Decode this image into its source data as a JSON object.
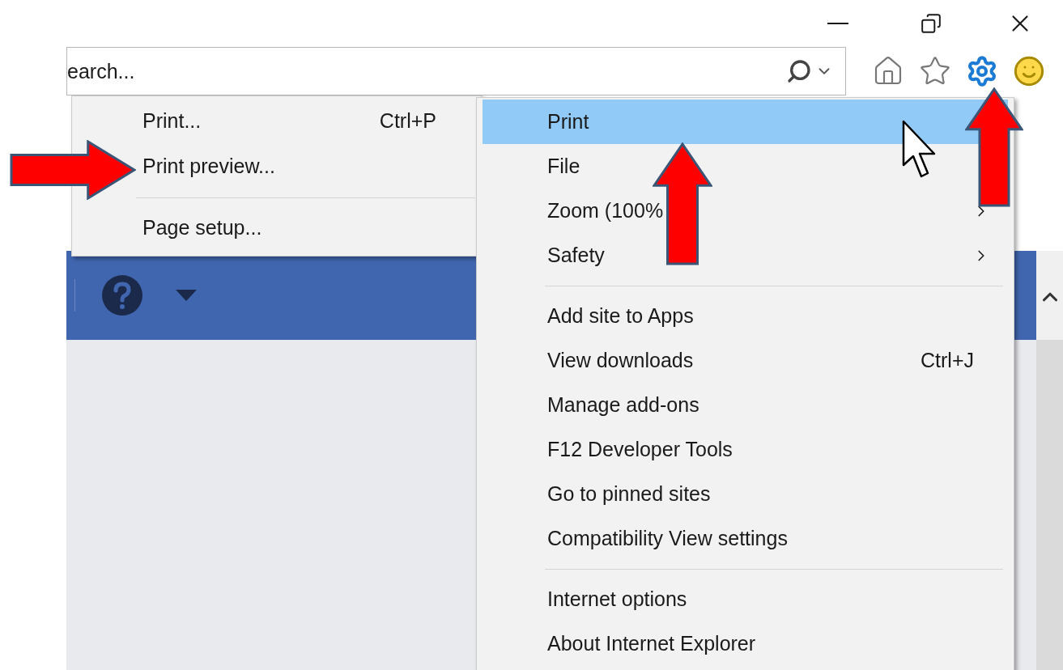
{
  "search": {
    "placeholder": "earch..."
  },
  "print_submenu": {
    "items": [
      {
        "kind": "item",
        "label": "Print...",
        "shortcut": "Ctrl+P"
      },
      {
        "kind": "item",
        "label": "Print preview..."
      },
      {
        "kind": "separator"
      },
      {
        "kind": "item",
        "label": "Page setup..."
      }
    ]
  },
  "tools_menu": {
    "items": [
      {
        "kind": "item",
        "label": "Print",
        "selected": true,
        "submenu": false
      },
      {
        "kind": "item",
        "label": "File",
        "selected": false,
        "submenu": false
      },
      {
        "kind": "item",
        "label": "Zoom (100%",
        "selected": false,
        "submenu": true
      },
      {
        "kind": "item",
        "label": "Safety",
        "selected": false,
        "submenu": true
      },
      {
        "kind": "separator"
      },
      {
        "kind": "item",
        "label": "Add site to Apps",
        "selected": false,
        "submenu": false
      },
      {
        "kind": "item",
        "label": "View downloads",
        "shortcut": "Ctrl+J",
        "selected": false,
        "submenu": false
      },
      {
        "kind": "item",
        "label": "Manage add-ons",
        "selected": false,
        "submenu": false
      },
      {
        "kind": "item",
        "label": "F12 Developer Tools",
        "selected": false,
        "submenu": false
      },
      {
        "kind": "item",
        "label": "Go to pinned sites",
        "selected": false,
        "submenu": false
      },
      {
        "kind": "item",
        "label": "Compatibility View settings",
        "selected": false,
        "submenu": false
      },
      {
        "kind": "separator"
      },
      {
        "kind": "item",
        "label": "Internet options",
        "selected": false,
        "submenu": false
      },
      {
        "kind": "item",
        "label": "About Internet Explorer",
        "selected": false,
        "submenu": false
      }
    ]
  }
}
